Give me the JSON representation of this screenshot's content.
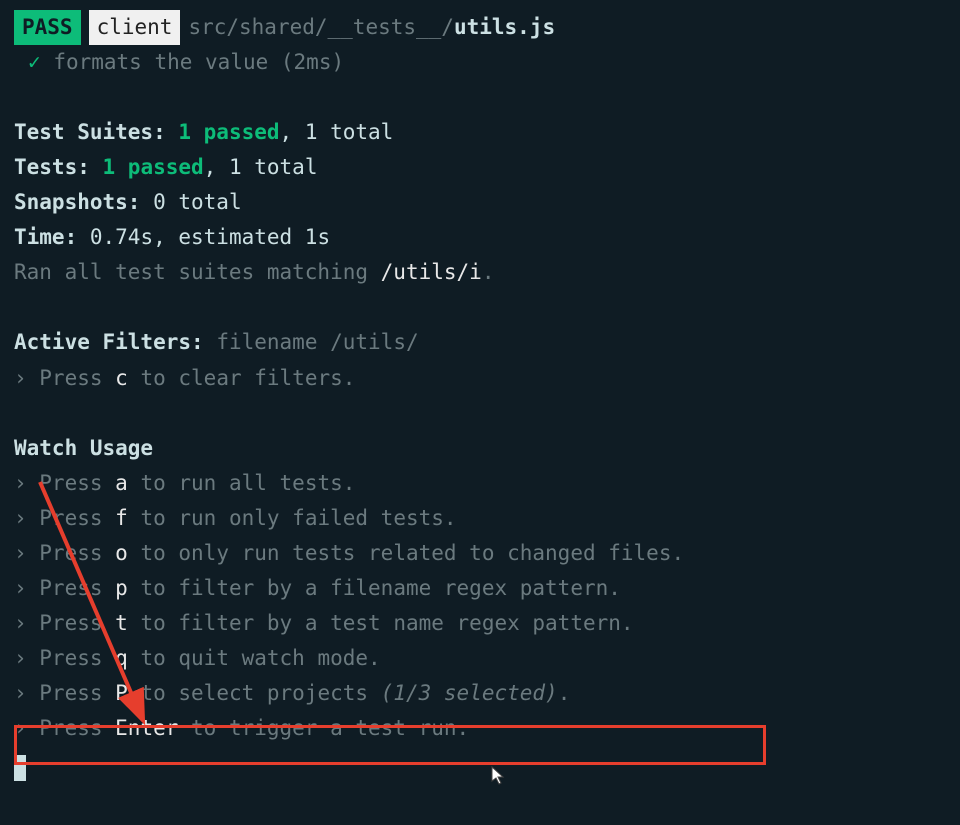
{
  "header": {
    "pass_label": "PASS",
    "client_label": "client",
    "path_dim": "src/shared/__tests__/",
    "path_bright": "utils.js"
  },
  "test_result": {
    "checkmark": "✓",
    "description": "formats the value (2ms)"
  },
  "summary": {
    "test_suites_label": "Test Suites:",
    "test_suites_passed": "1 passed",
    "test_suites_total": ", 1 total",
    "tests_label": "Tests:",
    "tests_passed": "1 passed",
    "tests_total": ", 1 total",
    "snapshots_label": "Snapshots:",
    "snapshots_value": "0 total",
    "time_label": "Time:",
    "time_value": "0.74s, estimated 1s",
    "ran_prefix": "Ran all test suites matching ",
    "ran_pattern": "/utils/i",
    "ran_suffix": "."
  },
  "active_filters": {
    "label": "Active Filters:",
    "value": "filename /utils/",
    "clear_prefix": " › Press ",
    "clear_key": "c",
    "clear_suffix": " to clear filters."
  },
  "watch_usage": {
    "header": "Watch Usage",
    "lines": [
      {
        "prefix": " › Press ",
        "key": "a",
        "suffix": " to run all tests."
      },
      {
        "prefix": " › Press ",
        "key": "f",
        "suffix": " to run only failed tests."
      },
      {
        "prefix": " › Press ",
        "key": "o",
        "suffix": " to only run tests related to changed files."
      },
      {
        "prefix": " › Press ",
        "key": "p",
        "suffix": " to filter by a filename regex pattern."
      },
      {
        "prefix": " › Press ",
        "key": "t",
        "suffix": " to filter by a test name regex pattern."
      },
      {
        "prefix": " › Press ",
        "key": "q",
        "suffix": " to quit watch mode."
      },
      {
        "prefix": " › Press ",
        "key": "P",
        "suffix_a": " to select projects ",
        "suffix_italic": "(1/3 selected)",
        "suffix_b": "."
      },
      {
        "prefix": " › Press ",
        "key": "Enter",
        "suffix": " to trigger a test run."
      }
    ]
  }
}
